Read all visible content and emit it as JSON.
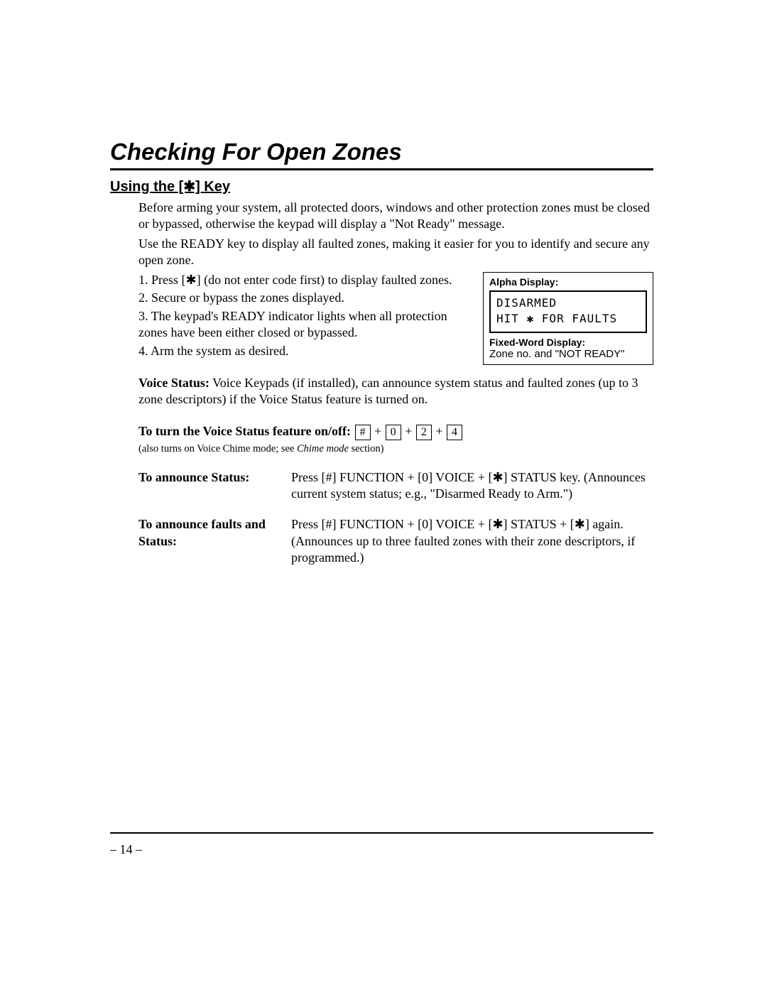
{
  "title": "Checking For Open Zones",
  "section_heading": "Using the [✱] Key",
  "intro_para_1": "Before arming your system, all protected doors, windows and other protection zones must be closed or bypassed, otherwise the keypad will display a \"Not Ready\" message.",
  "intro_para_2": "Use the READY key to display all faulted zones, making it easier for you to identify and secure any open zone.",
  "steps": [
    "1.  Press [✱] (do not enter code first) to display faulted zones.",
    "2.  Secure or bypass the zones displayed.",
    "3.  The keypad's READY indicator lights when all protection zones have been either closed or bypassed.",
    "4.  Arm the system as desired."
  ],
  "display": {
    "alpha_label": "Alpha Display:",
    "lcd_line1": "DISARMED",
    "lcd_line2": "HIT ✱ FOR FAULTS",
    "fixed_label": "Fixed-Word Display:",
    "fixed_text": "Zone no. and \"NOT READY\""
  },
  "voice_status_label": "Voice Status:",
  "voice_status_text": " Voice Keypads (if installed), can announce system status and faulted zones (up to 3 zone descriptors) if the Voice Status feature is turned on.",
  "voice_toggle_label": "To turn the Voice Status feature on/off:",
  "keys": [
    "#",
    "0",
    "2",
    "4"
  ],
  "key_sep": " + ",
  "note_prefix": "(also turns on Voice Chime mode; see ",
  "note_italic": "Chime mode",
  "note_suffix": " section)",
  "rows": [
    {
      "label": "To announce Status:",
      "text": "Press [#] FUNCTION + [0] VOICE + [✱] STATUS key. (Announces current system status; e.g., \"Disarmed Ready to Arm.\")"
    },
    {
      "label": "To announce faults and Status:",
      "text": "Press [#] FUNCTION + [0] VOICE + [✱] STATUS + [✱] again.  (Announces up to three faulted zones with their zone descriptors, if programmed.)"
    }
  ],
  "page_number": "– 14 –"
}
